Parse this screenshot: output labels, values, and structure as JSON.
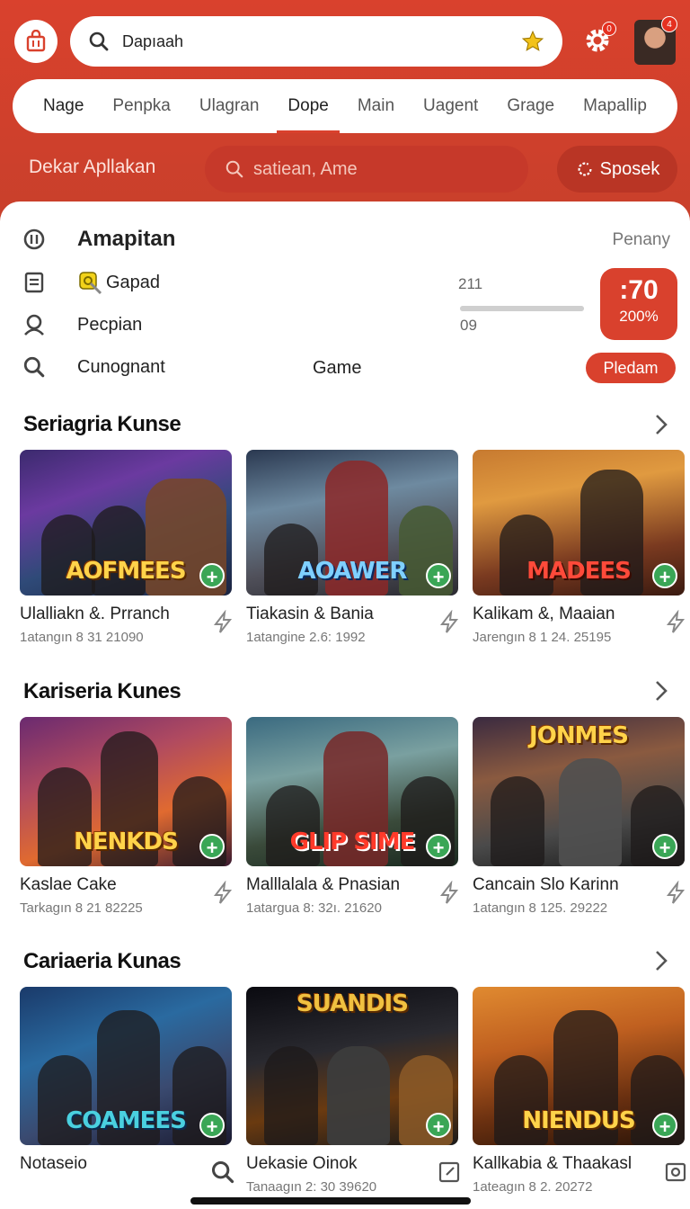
{
  "header": {
    "search_text": "Dapıaah",
    "gear_badge": "0",
    "avatar_badge": "4",
    "colors": {
      "primary": "#d9412d",
      "accent_green": "#3aa656",
      "star": "#f2c21a"
    }
  },
  "tabs": [
    {
      "label": "Nage"
    },
    {
      "label": "Penpka"
    },
    {
      "label": "Ulagran"
    },
    {
      "label": "Dope",
      "selected": true
    },
    {
      "label": "Main"
    },
    {
      "label": "Uagent"
    },
    {
      "label": "Grage"
    },
    {
      "label": "Mapallip"
    }
  ],
  "subheader": {
    "label": "Dekar Apllakan",
    "search_placeholder": "satiean, Ame",
    "button_label": "Sposek"
  },
  "menu": {
    "items": [
      {
        "label": "Amapitan",
        "icon": "coin-icon"
      },
      {
        "label": "Gapad",
        "icon": "document-icon"
      },
      {
        "label": "Pecpian",
        "icon": "person-icon"
      },
      {
        "label": "Cunognant",
        "icon": "search-icon"
      }
    ],
    "penany": "Penany",
    "stat_top": "211",
    "stat_bottom": "09",
    "progress_fraction": 1.0,
    "score_big": ":70",
    "score_small": "200%",
    "game_label": "Game",
    "pledam_label": "Pledam"
  },
  "sections": [
    {
      "title": "Seriagria Kunse",
      "cards": [
        {
          "logo": "AOFMEES",
          "title": "Ulalliakn &. Prranch",
          "meta": "1atangın 8 31 21090",
          "icon": "lightning-icon"
        },
        {
          "logo": "AOAWER",
          "title": "Tiakasin & Bania",
          "meta": "1atangine 2.6: 1992",
          "icon": "lightning-icon"
        },
        {
          "logo": "MADEES",
          "title": "Kalikam &, Maaian",
          "meta": "Jarengın 8 1 24. 25195",
          "icon": "lightning-icon"
        }
      ]
    },
    {
      "title": "Kariseria Kunes",
      "cards": [
        {
          "logo": "NENKDS",
          "title": "Kaslae Cake",
          "meta": "Tarkagın 8 21 82225",
          "icon": "lightning-icon"
        },
        {
          "logo": "GLIP SIME",
          "title": "Malllalala & Pnasian",
          "meta": "1atargua 8: 32ı. 21620",
          "icon": "lightning-icon"
        },
        {
          "logo": "JONMES",
          "title": "Cancain Slo Karinn",
          "meta": "1atangın 8 125. 29222",
          "icon": "lightning-icon"
        }
      ]
    },
    {
      "title": "Cariaeria Kunas",
      "cards": [
        {
          "logo": "COAMEES",
          "title": "Notaseio",
          "meta": "",
          "icon": "search-icon"
        },
        {
          "logo": "SUANDIS",
          "title": "Uekasie Oinok",
          "meta": "Tanaagın 2: 30 39620",
          "icon": "edit-icon"
        },
        {
          "logo": "NIENDUS",
          "title": "Kallkabia & Thaakasl",
          "meta": "1ateagın 8 2. 20272",
          "icon": "camera-icon"
        }
      ]
    }
  ]
}
